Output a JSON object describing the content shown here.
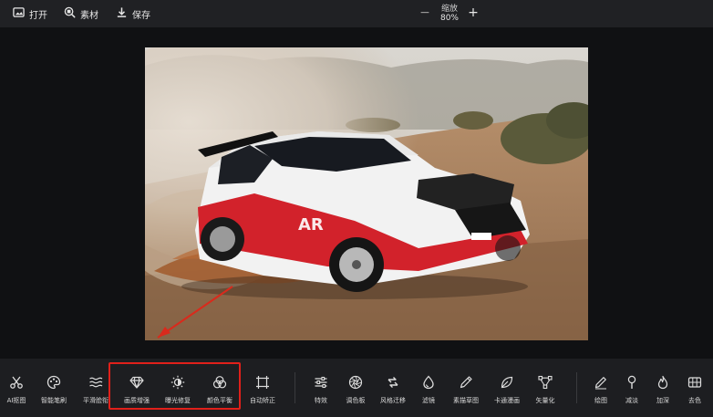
{
  "topbar": {
    "open_label": "打开",
    "material_label": "素材",
    "save_label": "保存",
    "zoom_label": "缩放",
    "zoom_value": "80%",
    "zoom_out": "−",
    "zoom_in": "+"
  },
  "canvas": {
    "photo_subject": "rally car on dirt road"
  },
  "tools": [
    {
      "label": "AI抠图",
      "icon": "scissors-icon"
    },
    {
      "label": "智能笔刷",
      "icon": "palette-icon"
    },
    {
      "label": "平滑脸衔",
      "icon": "waves-icon"
    },
    {
      "label": "画质增强",
      "icon": "diamond-icon"
    },
    {
      "label": "曝光修复",
      "icon": "exposure-icon"
    },
    {
      "label": "颜色平衡",
      "icon": "color-balance-icon"
    },
    {
      "label": "自动矫正",
      "icon": "frame-icon"
    },
    {
      "label": "特效",
      "icon": "sliders-icon"
    },
    {
      "label": "调色板",
      "icon": "aperture-icon"
    },
    {
      "label": "风格迁移",
      "icon": "style-transfer-icon"
    },
    {
      "label": "滤镜",
      "icon": "drop-icon"
    },
    {
      "label": "素描草图",
      "icon": "sketch-icon"
    },
    {
      "label": "卡通漫画",
      "icon": "cartoon-icon"
    },
    {
      "label": "矢量化",
      "icon": "vector-icon"
    },
    {
      "label": "绘图",
      "icon": "pen-icon"
    },
    {
      "label": "减淡",
      "icon": "dodge-icon"
    },
    {
      "label": "加深",
      "icon": "burn-icon"
    },
    {
      "label": "去色",
      "icon": "desaturate-icon"
    }
  ],
  "colors": {
    "topbar_bg": "#202124",
    "toolbar_bg": "#1d1e21",
    "canvas_bg": "#101113",
    "highlight": "#e0201a",
    "annotation_arrow": "#d92a1c"
  }
}
